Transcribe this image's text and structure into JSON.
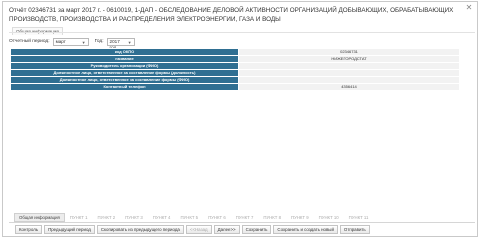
{
  "report": {
    "title": "Отчёт 02346731 за март 2017 г. - 0610019, 1-ДАП - ОБСЛЕДОВАНИЕ ДЕЛОВОЙ АКТИВНОСТИ ОРГАНИЗАЦИЙ ДОБЫВАЮЩИХ, ОБРАБАТЫВАЮЩИХ ПРОИЗВОДСТВ, ПРОИЗВОДСТВА И РАСПРЕДЕЛЕНИЯ ЭЛЕКТРОЭНЕРГИИ, ГАЗА И ВОДЫ",
    "section_tab": "Общая информация"
  },
  "period": {
    "period_label": "Отчетный период:",
    "period_value": "март",
    "year_label": "Год:",
    "year_value": "2017 год"
  },
  "info_rows": [
    {
      "label": "код ОКПО",
      "value": "02346731"
    },
    {
      "label": "название",
      "value": "НИЖЕГОРОДСТАТ"
    },
    {
      "label": "Руководитель организации (ФИО)",
      "value": ""
    },
    {
      "label": "Должностное лицо, ответственное за составление формы (должность)",
      "value": ""
    },
    {
      "label": "Должностное лицо, ответственное за составление формы (ФИО)",
      "value": ""
    },
    {
      "label": "Контактный телефон",
      "value": "4356414"
    }
  ],
  "tabs": [
    "Общая информация",
    "ПУНКТ 1",
    "ПУНКТ 2",
    "ПУНКТ 3",
    "ПУНКТ 4",
    "ПУНКТ 5",
    "ПУНКТ 6",
    "ПУНКТ 7",
    "ПУНКТ 8",
    "ПУНКТ 9",
    "ПУНКТ 10",
    "ПУНКТ 11"
  ],
  "buttons": {
    "control": "Контроль",
    "prev_period": "Предыдущий период",
    "copy_prev": "Скопировать из предыдущего периода",
    "back": "<<Назад",
    "next": "Далее>>",
    "save": "Сохранить",
    "save_new": "Сохранить и создать новый",
    "send": "Отправить"
  }
}
